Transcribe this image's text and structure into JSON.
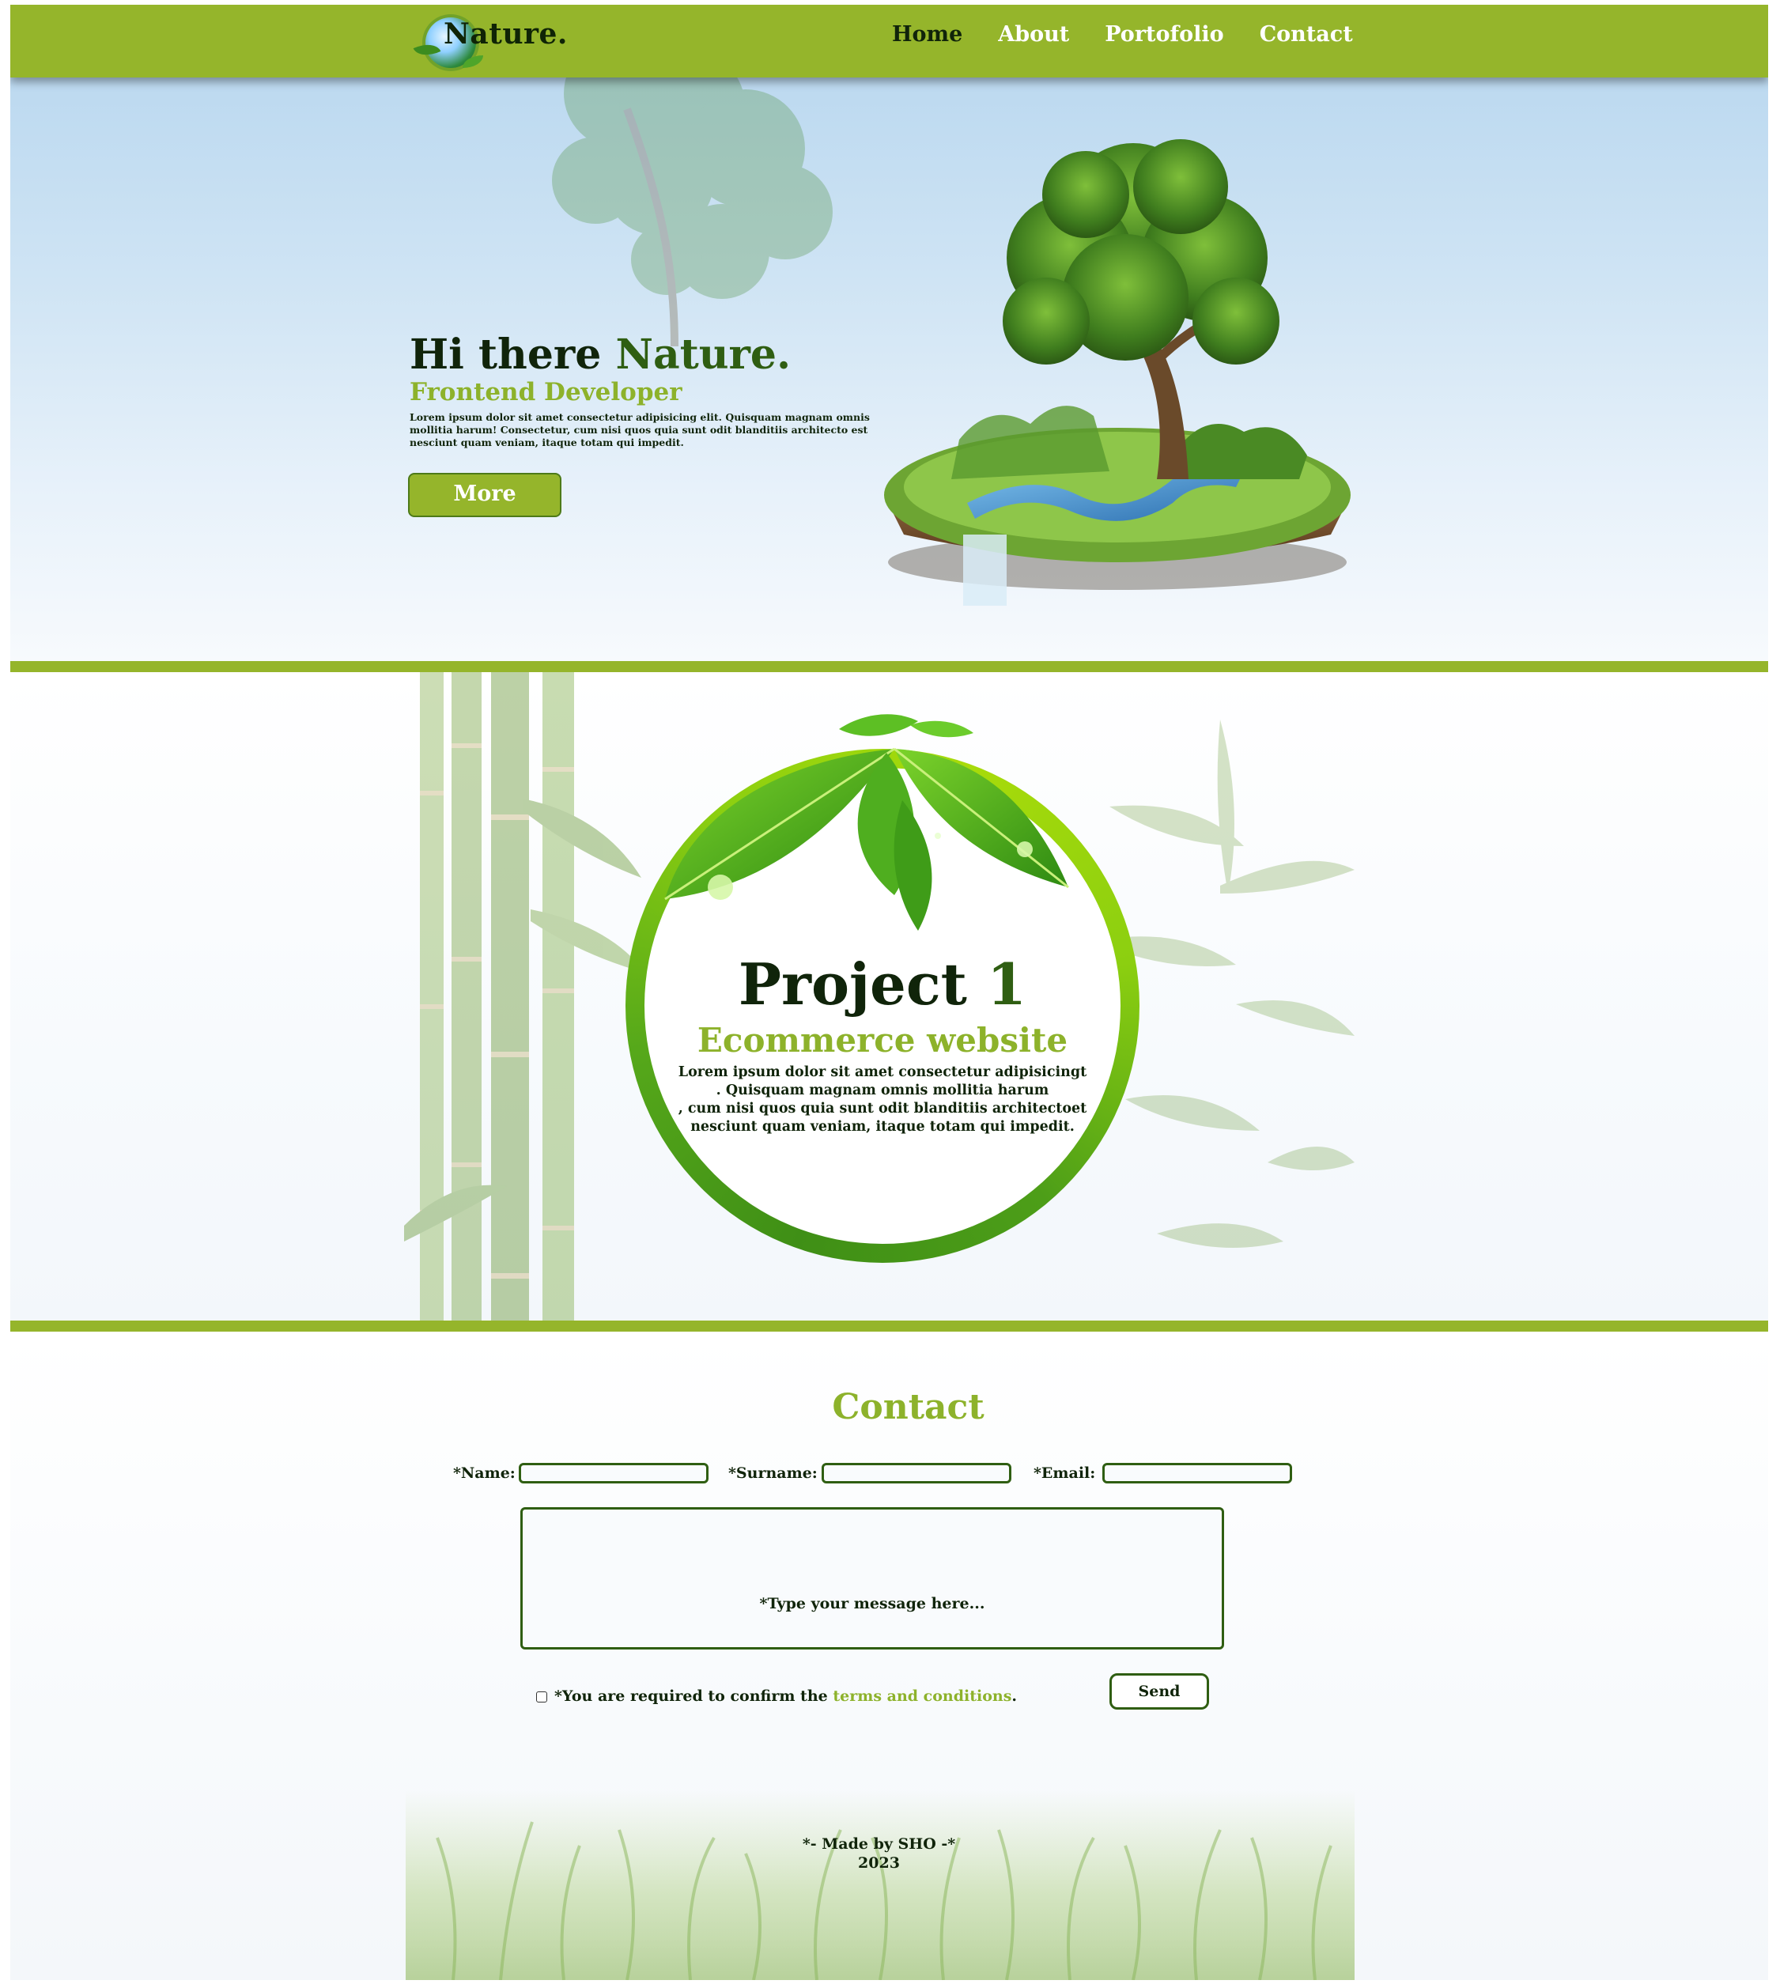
{
  "nav": {
    "logo_text": "Nature.",
    "links": [
      {
        "label": "Home",
        "active": true
      },
      {
        "label": "About",
        "active": false
      },
      {
        "label": "Portofolio",
        "active": false
      },
      {
        "label": "Contact",
        "active": false
      }
    ]
  },
  "hero": {
    "title_prefix": "Hi there ",
    "title_accent": "Nature.",
    "subtitle": "Frontend Developer",
    "body": "Lorem ipsum dolor sit amet consectetur adipisicing elit. Quisquam magnam omnis mollitia harum! Consectetur, cum nisi quos quia sunt odit blanditiis architecto est nesciunt quam veniam, itaque totam qui impedit.",
    "button_label": "More"
  },
  "project": {
    "title_word": "Project ",
    "title_number": "1",
    "subtitle": "Ecommerce website",
    "desc_line1": "Lorem ipsum dolor sit amet consectetur adipisicingt",
    "desc_line2": ". Quisquam magnam omnis mollitia harum",
    "desc_line3": ", cum nisi quos quia sunt odit blanditiis architectoet",
    "desc_line4": "nesciunt quam veniam, itaque totam qui impedit."
  },
  "contact": {
    "title": "Contact",
    "name_label": "*Name:",
    "surname_label": "*Surname:",
    "email_label": "*Email:",
    "message_placeholder": "*Type your message here...",
    "terms_prefix": "*You are required to confirm the ",
    "terms_link": "terms and conditions",
    "terms_suffix": ".",
    "send_label": "Send"
  },
  "footer": {
    "credit": "*- Made by SHO -*",
    "year": "2023"
  },
  "colors": {
    "brand_green": "#95b52b",
    "accent_green": "#8db22b",
    "dark_text": "#10240a",
    "dark_green": "#2f5e12"
  }
}
